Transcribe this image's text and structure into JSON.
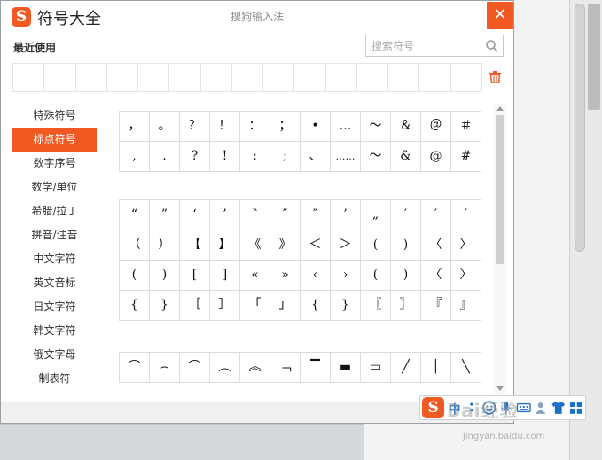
{
  "window": {
    "logo_text": "S",
    "title": "符号大全",
    "ime_name": "搜狗输入法",
    "close_label": "✕"
  },
  "recent": {
    "label": "最近使用"
  },
  "search": {
    "placeholder": "搜索符号",
    "value": ""
  },
  "sidebar": {
    "items": [
      {
        "label": "特殊符号"
      },
      {
        "label": "标点符号"
      },
      {
        "label": "数字序号"
      },
      {
        "label": "数学/单位"
      },
      {
        "label": "希腊/拉丁"
      },
      {
        "label": "拼音/注音"
      },
      {
        "label": "中文字符"
      },
      {
        "label": "英文音标"
      },
      {
        "label": "日文字符"
      },
      {
        "label": "韩文字符"
      },
      {
        "label": "俄文字母"
      },
      {
        "label": "制表符"
      }
    ],
    "active_index": 1
  },
  "symbol_groups": [
    [
      "，",
      "。",
      "？",
      "！",
      "：",
      "；",
      "•",
      "…",
      "～",
      "＆",
      "＠",
      "＃",
      ",",
      ".",
      "?",
      "!",
      ":",
      ";",
      "、",
      "……",
      "〜",
      "&",
      "@",
      "#"
    ],
    [
      "“",
      "”",
      "‘",
      "’",
      "‶",
      "″",
      "″",
      "’",
      "„",
      "′",
      "′",
      "′",
      "（",
      "）",
      "【",
      "】",
      "《",
      "》",
      "＜",
      "＞",
      "(",
      ")",
      "〈",
      "〉",
      "(",
      ")",
      "[",
      "]",
      "«",
      "»",
      "‹",
      "›",
      "(",
      ")",
      "〈",
      "〉",
      "{",
      "}",
      "［",
      "］",
      "「",
      "」",
      "{",
      "}",
      "〖",
      "〗",
      "『",
      "』"
    ],
    [
      "⌒",
      "⌢",
      "⌒",
      "︵",
      "︽",
      "﹁",
      "▔",
      "▬",
      "▭",
      "╱",
      "│",
      "╲"
    ]
  ],
  "ime_bar": {
    "logo_text": "S",
    "mode": "中"
  },
  "watermark": {
    "main": "Bai经验",
    "sub": "jingyan.baidu.com"
  },
  "colors": {
    "accent": "#f05a22",
    "ime_blue": "#1a6fc9"
  }
}
